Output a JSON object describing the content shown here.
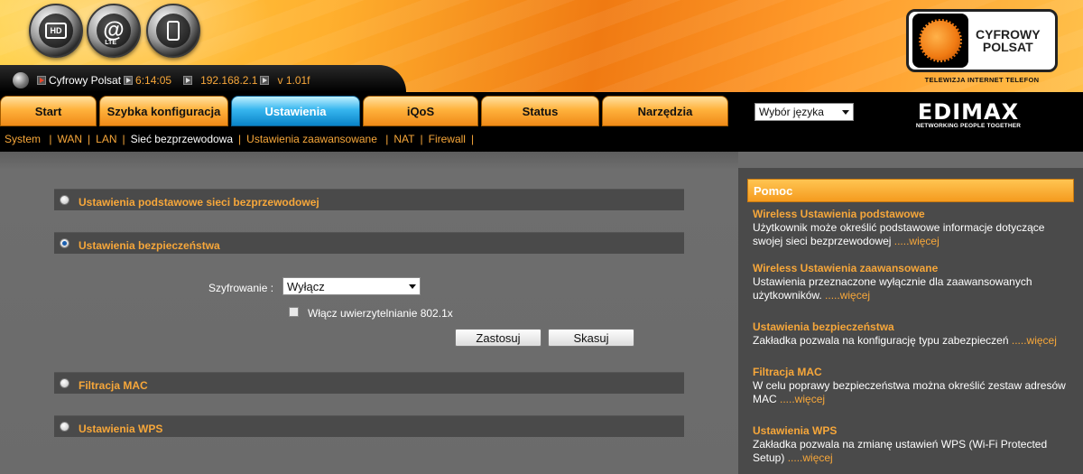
{
  "header": {
    "icons": {
      "hd": "HD",
      "lte": "LTE"
    },
    "status": {
      "provider": "Cyfrowy Polsat",
      "time": "6:14:05",
      "ip": "192.168.2.1",
      "version": "v 1.01f"
    },
    "logo": {
      "line1": "CYFROWY",
      "line2": "POLSAT",
      "tagline": "TELEWIZJA  INTERNET  TELEFON"
    },
    "edimax": {
      "brand": "EDIMAX",
      "tagline": "NETWORKING PEOPLE TOGETHER"
    }
  },
  "tabs": [
    {
      "label": "Start",
      "active": false
    },
    {
      "label": "Szybka konfiguracja",
      "active": false
    },
    {
      "label": "Ustawienia",
      "active": true
    },
    {
      "label": "iQoS",
      "active": false
    },
    {
      "label": "Status",
      "active": false
    },
    {
      "label": "Narzędzia",
      "active": false
    }
  ],
  "language_select": {
    "value": "Wybór języka"
  },
  "subnav": [
    {
      "label": "System ",
      "current": false
    },
    {
      "label": "WAN",
      "current": false
    },
    {
      "label": "LAN",
      "current": false
    },
    {
      "label": "Sieć bezprzewodowa",
      "current": true
    },
    {
      "label": "Ustawienia zaawansowane ",
      "current": false
    },
    {
      "label": "NAT",
      "current": false
    },
    {
      "label": "Firewall",
      "current": false
    }
  ],
  "sections": {
    "basic": "Ustawienia podstawowe sieci bezprzewodowej",
    "security": "Ustawienia bezpieczeństwa",
    "mac": "Filtracja MAC",
    "wps": "Ustawienia WPS"
  },
  "security_form": {
    "encryption_label": "Szyfrowanie :",
    "encryption_value": "Wyłącz",
    "auth_checkbox_label": "Włącz uwierzytelnianie 802.1x",
    "auth_checked": false,
    "apply_label": "Zastosuj",
    "reset_label": "Skasuj"
  },
  "help": {
    "title": "Pomoc",
    "entries": [
      {
        "title": "Wireless Ustawienia podstawowe",
        "text": "Użytkownik może określić podstawowe informacje dotyczące swojej sieci bezprzewodowej",
        "more": ".....więcej"
      },
      {
        "title": "Wireless Ustawienia zaawansowane",
        "text": "Ustawienia przeznaczone wyłącznie dla zaawansowanych użytkowników.",
        "more": ".....więcej"
      },
      {
        "title": "Ustawienia bezpieczeństwa",
        "text": "Zakładka pozwala na konfigurację typu zabezpieczeń",
        "more": ".....więcej"
      },
      {
        "title": "Filtracja MAC",
        "text": "W celu poprawy bezpieczeństwa można określić zestaw adresów MAC",
        "more": ".....więcej"
      },
      {
        "title": "Ustawienia WPS",
        "text": "Zakładka pozwala na zmianę ustawień WPS (Wi-Fi Protected Setup)",
        "more": ".....więcej"
      }
    ]
  }
}
